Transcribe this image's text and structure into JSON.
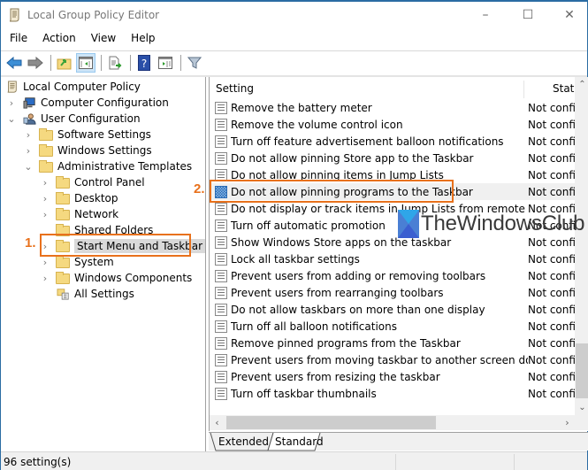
{
  "window": {
    "title": "Local Group Policy Editor",
    "controls": {
      "minimize": "–",
      "maximize": "☐",
      "close": "✕"
    }
  },
  "menu": [
    "File",
    "Action",
    "View",
    "Help"
  ],
  "toolbar": {
    "buttons": [
      {
        "name": "back",
        "icon": "back-arrow-icon"
      },
      {
        "name": "forward",
        "icon": "forward-arrow-icon"
      },
      {
        "name": "up-one-level",
        "icon": "folder-up-icon"
      },
      {
        "name": "show-hide-console-tree",
        "icon": "console-tree-icon",
        "active": true
      },
      {
        "name": "export-list",
        "icon": "export-list-icon"
      },
      {
        "name": "help",
        "icon": "help-icon"
      },
      {
        "name": "show-hide-action-pane",
        "icon": "action-pane-icon"
      },
      {
        "name": "filter",
        "icon": "filter-icon"
      }
    ]
  },
  "tree": {
    "items": [
      {
        "label": "Local Computer Policy",
        "level": 0,
        "expander": "",
        "icon": "policy-scroll-icon"
      },
      {
        "label": "Computer Configuration",
        "level": 1,
        "expander": "›",
        "icon": "computer-icon"
      },
      {
        "label": "User Configuration",
        "level": 1,
        "expander": "⌄",
        "icon": "user-icon"
      },
      {
        "label": "Software Settings",
        "level": 2,
        "expander": "›",
        "icon": "folder-icon"
      },
      {
        "label": "Windows Settings",
        "level": 2,
        "expander": "›",
        "icon": "folder-icon"
      },
      {
        "label": "Administrative Templates",
        "level": 2,
        "expander": "⌄",
        "icon": "folder-icon"
      },
      {
        "label": "Control Panel",
        "level": 3,
        "expander": "›",
        "icon": "folder-icon"
      },
      {
        "label": "Desktop",
        "level": 3,
        "expander": "›",
        "icon": "folder-icon"
      },
      {
        "label": "Network",
        "level": 3,
        "expander": "›",
        "icon": "folder-icon"
      },
      {
        "label": "Shared Folders",
        "level": 3,
        "expander": "",
        "icon": "folder-icon"
      },
      {
        "label": "Start Menu and Taskbar",
        "level": 3,
        "expander": "›",
        "icon": "folder-icon",
        "selected": true
      },
      {
        "label": "System",
        "level": 3,
        "expander": "›",
        "icon": "folder-icon"
      },
      {
        "label": "Windows Components",
        "level": 3,
        "expander": "›",
        "icon": "folder-icon"
      },
      {
        "label": "All Settings",
        "level": 3,
        "expander": "",
        "icon": "all-settings-icon"
      }
    ]
  },
  "list": {
    "columns": {
      "setting": "Setting",
      "state": "State"
    },
    "rows": [
      {
        "setting": "Remove the battery meter",
        "state": "Not configured"
      },
      {
        "setting": "Remove the volume control icon",
        "state": "Not configured"
      },
      {
        "setting": "Turn off feature advertisement balloon notifications",
        "state": "Not configured"
      },
      {
        "setting": "Do not allow pinning Store app to the Taskbar",
        "state": "Not configured"
      },
      {
        "setting": "Do not allow pinning items in Jump Lists",
        "state": "Not configured"
      },
      {
        "setting": "Do not allow pinning programs to the Taskbar",
        "state": "Not configured",
        "selected": true
      },
      {
        "setting": "Do not display or track items in Jump Lists from remote loca...",
        "state": "Not configured"
      },
      {
        "setting": "Turn off automatic promotion",
        "state": "Not configured"
      },
      {
        "setting": "Show Windows Store apps on the taskbar",
        "state": "Not configured"
      },
      {
        "setting": "Lock all taskbar settings",
        "state": "Not configured"
      },
      {
        "setting": "Prevent users from adding or removing toolbars",
        "state": "Not configured"
      },
      {
        "setting": "Prevent users from rearranging toolbars",
        "state": "Not configured"
      },
      {
        "setting": "Do not allow taskbars on more than one display",
        "state": "Not configured"
      },
      {
        "setting": "Turn off all balloon notifications",
        "state": "Not configured"
      },
      {
        "setting": "Remove pinned programs from the Taskbar",
        "state": "Not configured"
      },
      {
        "setting": "Prevent users from moving taskbar to another screen dock l...",
        "state": "Not configured"
      },
      {
        "setting": "Prevent users from resizing the taskbar",
        "state": "Not configured"
      },
      {
        "setting": "Turn off taskbar thumbnails",
        "state": "Not configured"
      }
    ],
    "scroll": {
      "vertical_position": 0.85
    }
  },
  "tabs": [
    {
      "label": "Extended",
      "active": false
    },
    {
      "label": "Standard",
      "active": true
    }
  ],
  "status": {
    "text": "96 setting(s)"
  },
  "annotations": {
    "step1": "1.",
    "step2": "2.",
    "color": "#e8711c"
  },
  "watermark": {
    "text": "TheWindowsClub"
  }
}
